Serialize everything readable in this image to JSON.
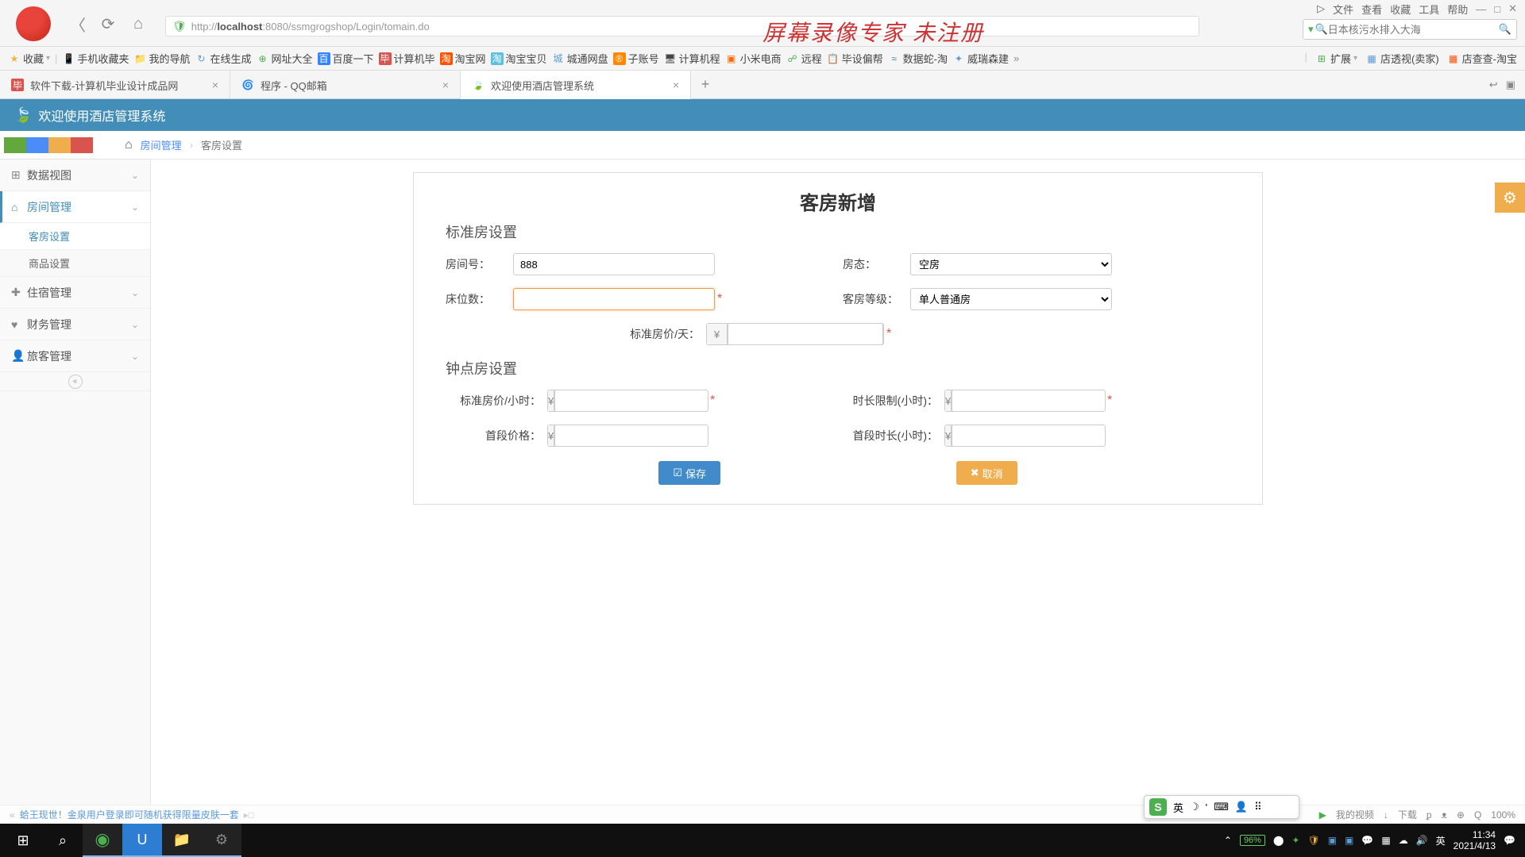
{
  "browser": {
    "url_prefix": "http://",
    "url_host": "localhost",
    "url_rest": ":8080/ssmgrogshop/Login/tomain.do",
    "watermark": "屏幕录像专家  未注册",
    "top_menu": [
      "文件",
      "查看",
      "收藏",
      "工具",
      "帮助"
    ],
    "search_placeholder": "日本核污水排入大海"
  },
  "bookmarks": {
    "items": [
      {
        "icon": "⭐",
        "label": "收藏",
        "color": "#f6b042"
      },
      {
        "icon": "📱",
        "label": "手机收藏夹",
        "color": "#777"
      },
      {
        "icon": "📁",
        "label": "我的导航",
        "color": "#f6b042"
      },
      {
        "icon": "🔁",
        "label": "在线生成",
        "color": "#5b9bd5"
      },
      {
        "icon": "🌐",
        "label": "网址大全",
        "color": "#4caf50"
      },
      {
        "icon": "🅱",
        "label": "百度一下",
        "color": "#3385ff"
      },
      {
        "icon": "毕",
        "label": "计算机毕",
        "color": "#d9534f"
      },
      {
        "icon": "淘",
        "label": "淘宝网",
        "color": "#ff5000"
      },
      {
        "icon": "淘",
        "label": "淘宝宝贝",
        "color": "#5bc0de"
      },
      {
        "icon": "城",
        "label": "城通网盘",
        "color": "#5b9bd5"
      },
      {
        "icon": "®",
        "label": "子账号",
        "color": "#ff8800"
      },
      {
        "icon": "🖥",
        "label": "计算机程",
        "color": "#888"
      },
      {
        "icon": "🔳",
        "label": "小米电商",
        "color": "#ff6700"
      },
      {
        "icon": "🔗",
        "label": "远程",
        "color": "#4caf50"
      },
      {
        "icon": "📋",
        "label": "毕设偏帮",
        "color": "#888"
      },
      {
        "icon": "🐍",
        "label": "数据蛇-淘",
        "color": "#888"
      },
      {
        "icon": "🧭",
        "label": "威瑞森建",
        "color": "#888"
      }
    ],
    "right": [
      {
        "icon": "🧩",
        "label": "扩展"
      },
      {
        "icon": "🛒",
        "label": "店透视(卖家)"
      },
      {
        "icon": "🔍",
        "label": "店查查-淘宝"
      }
    ]
  },
  "tabs": [
    {
      "icon": "毕",
      "label": "软件下载-计算机毕业设计成品网",
      "active": false,
      "iconbg": "#d9534f"
    },
    {
      "icon": "🌀",
      "label": "程序 - QQ邮箱",
      "active": false,
      "iconbg": "#fff"
    },
    {
      "icon": "🍃",
      "label": "欢迎使用酒店管理系统",
      "active": true,
      "iconbg": "#fff"
    }
  ],
  "app": {
    "title": "欢迎使用酒店管理系统"
  },
  "breadcrumb": {
    "link": "房间管理",
    "current": "客房设置"
  },
  "sidebar": {
    "items": [
      {
        "icon": "⊞",
        "label": "数据视图",
        "open": false
      },
      {
        "icon": "⌂",
        "label": "房间管理",
        "open": true,
        "active": true,
        "subs": [
          {
            "label": "客房设置",
            "active": true
          },
          {
            "label": "商品设置",
            "active": false
          }
        ]
      },
      {
        "icon": "✚",
        "label": "住宿管理",
        "open": false
      },
      {
        "icon": "♥",
        "label": "财务管理",
        "open": false
      },
      {
        "icon": "👤",
        "label": "旅客管理",
        "open": false
      }
    ]
  },
  "form": {
    "title": "客房新增",
    "section1": "标准房设置",
    "room_no_label": "房间号：",
    "room_no_value": "888",
    "status_label": "房态：",
    "status_value": "空房",
    "beds_label": "床位数：",
    "beds_value": "",
    "level_label": "客房等级：",
    "level_value": "单人普通房",
    "std_price_label": "标准房价/天：",
    "section2": "钟点房设置",
    "hr_price_label": "标准房价/小时：",
    "hr_limit_label": "时长限制(小时)：",
    "first_price_label": "首段价格：",
    "first_len_label": "首段时长(小时)：",
    "currency": "¥",
    "save": "保存",
    "cancel": "取消"
  },
  "status_bar": {
    "left": "蛤王现世！金泉用户登录即可随机获得限量皮肤一套",
    "right_items": [
      "我的视频",
      "下载",
      "ᵱ",
      "ᴥ",
      "⊕",
      "Q",
      "100%"
    ]
  },
  "ime": {
    "lang": "英"
  },
  "taskbar": {
    "time": "11:34",
    "date": "2021/4/13",
    "battery": "96%",
    "lang": "英"
  }
}
